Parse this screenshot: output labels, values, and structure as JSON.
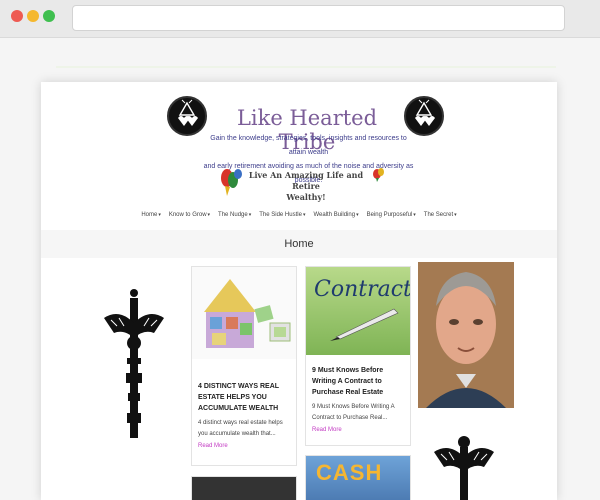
{
  "header": {
    "site_title": "Like Hearted Tribe",
    "tagline_line1": "Gain the knowledge, strategies, tools, insights and resources to attain wealth",
    "tagline_line2": "and early retirement avoiding as much of the noise and adversity as possible.",
    "motto_line1": "Live An Amazing Life and Retire",
    "motto_line2": "Wealthy!"
  },
  "nav": {
    "items": [
      {
        "label": "Home"
      },
      {
        "label": "Know to Grow"
      },
      {
        "label": "The Nudge"
      },
      {
        "label": "The Side Hustle"
      },
      {
        "label": "Wealth Building"
      },
      {
        "label": "Being Purposeful"
      },
      {
        "label": "The Secret"
      }
    ],
    "caret": "▾"
  },
  "page_title": "Home",
  "posts": [
    {
      "title": "4 DISTINCT WAYS REAL ESTATE HELPS YOU ACCUMULATE WEALTH",
      "excerpt": "4 distinct ways real estate helps you accumulate wealth that...",
      "more": "Read More",
      "image": "puzzle-house-money"
    },
    {
      "title": "9 Must Knows Before Writing A Contract to Purchase Real Estate",
      "excerpt": "9 Must Knows Before Writing A Contract to Purchase Real...",
      "more": "Read More",
      "image_text": "Contract."
    }
  ],
  "card4_image_text": "CASH",
  "colors": {
    "title": "#7b5d98",
    "tagline": "#3d3d8b",
    "read_more": "#c33bc3"
  }
}
